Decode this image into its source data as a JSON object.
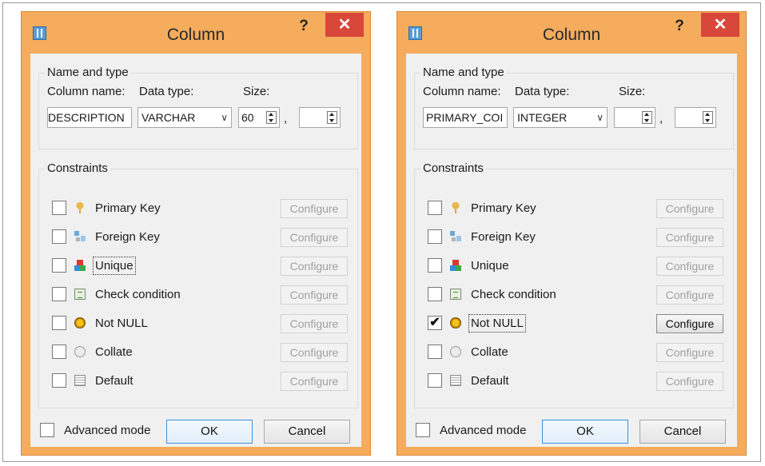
{
  "dialogs": [
    {
      "title": "Column",
      "help": "?",
      "close": "✕",
      "name_group": {
        "legend": "Name and type",
        "column_name_label": "Column name:",
        "data_type_label": "Data type:",
        "size_label": "Size:",
        "column_name_value": "DESCRIPTION",
        "data_type_value": "VARCHAR",
        "size_value": "60",
        "comma": ",",
        "scale_value": ""
      },
      "constraints_group": {
        "legend": "Constraints",
        "items": [
          {
            "label": "Primary Key",
            "icon": "key-icon",
            "checked": false,
            "configure": "Configure",
            "configure_enabled": false
          },
          {
            "label": "Foreign Key",
            "icon": "foreign-key-icon",
            "checked": false,
            "configure": "Configure",
            "configure_enabled": false
          },
          {
            "label": "Unique",
            "icon": "unique-icon",
            "checked": false,
            "configure": "Configure",
            "configure_enabled": false
          },
          {
            "label": "Check condition",
            "icon": "check-condition-icon",
            "checked": false,
            "configure": "Configure",
            "configure_enabled": false
          },
          {
            "label": "Not NULL",
            "icon": "not-null-icon",
            "checked": false,
            "configure": "Configure",
            "configure_enabled": false
          },
          {
            "label": "Collate",
            "icon": "collate-icon",
            "checked": false,
            "configure": "Configure",
            "configure_enabled": false
          },
          {
            "label": "Default",
            "icon": "default-icon",
            "checked": false,
            "configure": "Configure",
            "configure_enabled": false
          }
        ]
      },
      "advanced_mode": "Advanced mode",
      "ok": "OK",
      "cancel": "Cancel"
    },
    {
      "title": "Column",
      "help": "?",
      "close": "✕",
      "name_group": {
        "legend": "Name and type",
        "column_name_label": "Column name:",
        "data_type_label": "Data type:",
        "size_label": "Size:",
        "column_name_value": "PRIMARY_COI",
        "data_type_value": "INTEGER",
        "size_value": "",
        "comma": ",",
        "scale_value": ""
      },
      "constraints_group": {
        "legend": "Constraints",
        "items": [
          {
            "label": "Primary Key",
            "icon": "key-icon",
            "checked": false,
            "configure": "Configure",
            "configure_enabled": false
          },
          {
            "label": "Foreign Key",
            "icon": "foreign-key-icon",
            "checked": false,
            "configure": "Configure",
            "configure_enabled": false
          },
          {
            "label": "Unique",
            "icon": "unique-icon",
            "checked": false,
            "configure": "Configure",
            "configure_enabled": false
          },
          {
            "label": "Check condition",
            "icon": "check-condition-icon",
            "checked": false,
            "configure": "Configure",
            "configure_enabled": false
          },
          {
            "label": "Not NULL",
            "icon": "not-null-icon",
            "checked": true,
            "configure": "Configure",
            "configure_enabled": true
          },
          {
            "label": "Collate",
            "icon": "collate-icon",
            "checked": false,
            "configure": "Configure",
            "configure_enabled": false
          },
          {
            "label": "Default",
            "icon": "default-icon",
            "checked": false,
            "configure": "Configure",
            "configure_enabled": false
          }
        ]
      },
      "advanced_mode": "Advanced mode",
      "ok": "OK",
      "cancel": "Cancel"
    }
  ],
  "colors": {
    "title_bar": "#f5ac5c",
    "close_button": "#d9463a",
    "dialog_body": "#f0f0f0",
    "ok_focus_border": "#3c8fd6"
  }
}
